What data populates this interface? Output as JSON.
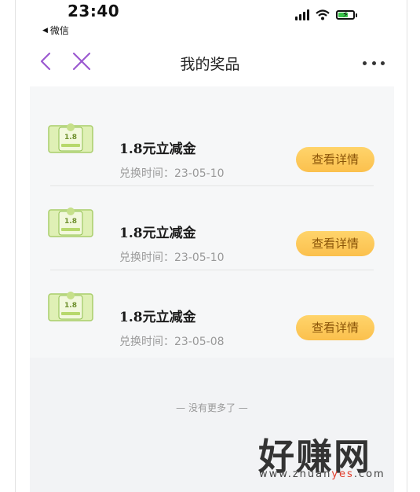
{
  "status_bar": {
    "time": "23:40",
    "back_app": "微信",
    "icons": [
      "signal-icon",
      "wifi-icon",
      "battery-charging-icon"
    ]
  },
  "nav": {
    "title": "我的奖品",
    "back_icon": "chevron-left-icon",
    "close_icon": "close-icon",
    "more_icon": "more-icon"
  },
  "prizes": [
    {
      "name": "1.8元立减金",
      "date_label": "兑换时间：",
      "date": "23-05-10",
      "button": "查看详情",
      "thumb_text": "1.8"
    },
    {
      "name": "1.8元立减金",
      "date_label": "兑换时间：",
      "date": "23-05-10",
      "button": "查看详情",
      "thumb_text": "1.8"
    },
    {
      "name": "1.8元立减金",
      "date_label": "兑换时间：",
      "date": "23-05-08",
      "button": "查看详情",
      "thumb_text": "1.8"
    }
  ],
  "footer": "— 没有更多了 —",
  "watermark": {
    "title": "好赚网",
    "url_prefix": "www.zhuan",
    "url_accent": "yes",
    "url_suffix": ".com"
  },
  "colors": {
    "accent_purple": "#9b59d0",
    "button_gold": "#fbc04d",
    "button_text": "#8a5408",
    "content_bg": "#f2f3f5"
  }
}
